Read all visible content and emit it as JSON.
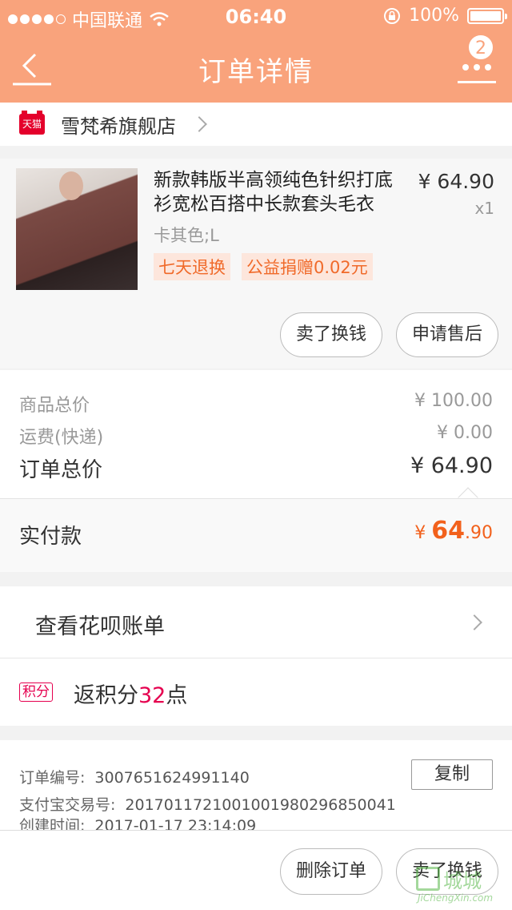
{
  "status_bar": {
    "carrier": "中国联通",
    "time": "06:40",
    "battery": "100%"
  },
  "nav": {
    "title": "订单详情",
    "badge_count": "2"
  },
  "shop": {
    "logo_text": "天猫",
    "name": "雪梵希旗舰店"
  },
  "item": {
    "title": "新款韩版半高领纯色针织打底衫宽松百搭中长款套头毛衣",
    "price": "¥ 64.90",
    "quantity": "x1",
    "sku": "卡其色;L",
    "tags": [
      "七天退换",
      "公益捐赠0.02元"
    ],
    "actions": [
      "卖了换钱",
      "申请售后"
    ]
  },
  "summary": {
    "goods_label": "商品总价",
    "goods_value": "¥ 100.00",
    "shipping_label": "运费(快递)",
    "shipping_value": "¥ 0.00",
    "total_label": "订单总价",
    "total_value": "¥ 64.90",
    "paid_label": "实付款",
    "paid_currency": "¥ ",
    "paid_int": "64",
    "paid_dec": ".90"
  },
  "huabei": {
    "label": "查看花呗账单"
  },
  "points": {
    "icon_text": "积分",
    "prefix": "返积分",
    "number": "32",
    "suffix": "点"
  },
  "order_info": {
    "order_no_label": "订单编号:",
    "order_no": "3007651624991140",
    "copy_label": "复制",
    "alipay_label": "支付宝交易号:",
    "alipay_no": "2017011721001001980296850041",
    "created_label": "创建时间:",
    "created_time": "2017-01-17 23:14:09"
  },
  "bottom": {
    "delete_label": "删除订单",
    "sell_label": "卖了换钱"
  },
  "watermark": {
    "text": "城城",
    "sub": "JiChengXin.com"
  },
  "colors": {
    "header": "#f9a37c",
    "accent": "#f2611c",
    "points": "#e5004f"
  }
}
